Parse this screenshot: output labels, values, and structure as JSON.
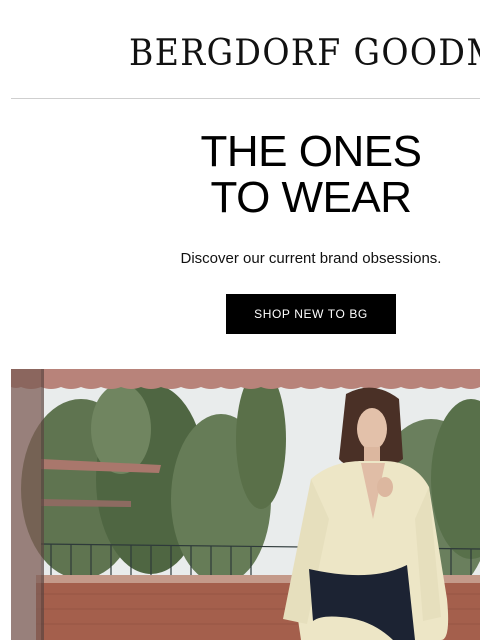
{
  "header": {
    "brand_logo_text": "BERGDORF GOODMAN"
  },
  "hero_text": {
    "headline_line1": "THE ONES",
    "headline_line2": "TO WEAR",
    "subtext": "Discover our current brand obsessions.",
    "cta_label": "SHOP NEW TO BG"
  },
  "hero_image": {
    "subject": "model in cream dress with navy belt on terrace"
  },
  "colors": {
    "cta_background": "#000000",
    "cta_text": "#ffffff",
    "divider": "#cfcfcf"
  }
}
